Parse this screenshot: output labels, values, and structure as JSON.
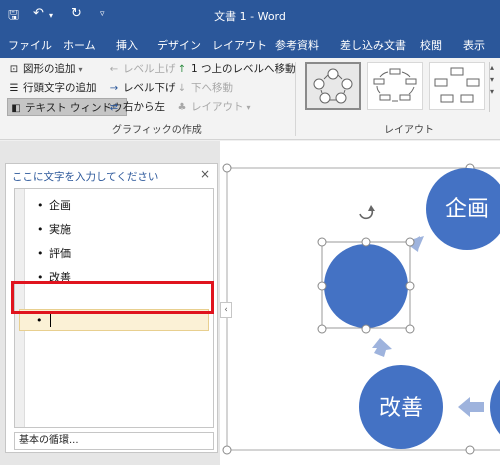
{
  "titlebar": {
    "save_icon": "save-icon",
    "undo_icon": "undo-icon",
    "redo_icon": "redo-icon",
    "customize_icon": "chevron-down-icon",
    "title": "文書 1 - Word",
    "color": "#2b579a"
  },
  "menu": {
    "tabs": [
      {
        "label": "ファイル"
      },
      {
        "label": "ホーム"
      },
      {
        "label": "挿入"
      },
      {
        "label": "デザイン"
      },
      {
        "label": "レイアウト"
      },
      {
        "label": "参考資料"
      },
      {
        "label": "差し込み文書"
      },
      {
        "label": "校閲"
      },
      {
        "label": "表示"
      }
    ]
  },
  "ribbon": {
    "create_graphic": {
      "add_shape": "図形の追加",
      "add_bullet": "行頭文字の追加",
      "text_pane": "テキスト ウィンドウ",
      "promote": "レベル上げ",
      "demote": "レベル下げ",
      "right_to_left": "右から左",
      "move_up": "1 つ上のレベルへ移動",
      "move_down": "下へ移動",
      "layout": "レイアウト",
      "group_label": "グラフィックの作成"
    },
    "layouts": {
      "group_label": "レイアウト"
    }
  },
  "text_pane": {
    "header": "ここに文字を入力してください",
    "close": "×",
    "items": [
      "企画",
      "実施",
      "評価",
      "改善"
    ],
    "bullet": "•",
    "new_item_value": "",
    "footer": "基本の循環...",
    "collapse_glyph": "‹"
  },
  "smartart": {
    "labels": {
      "plan": "企画",
      "improve": "改善"
    },
    "circle_color": "#4472c4",
    "arrow_color": "#9eb3dd"
  }
}
